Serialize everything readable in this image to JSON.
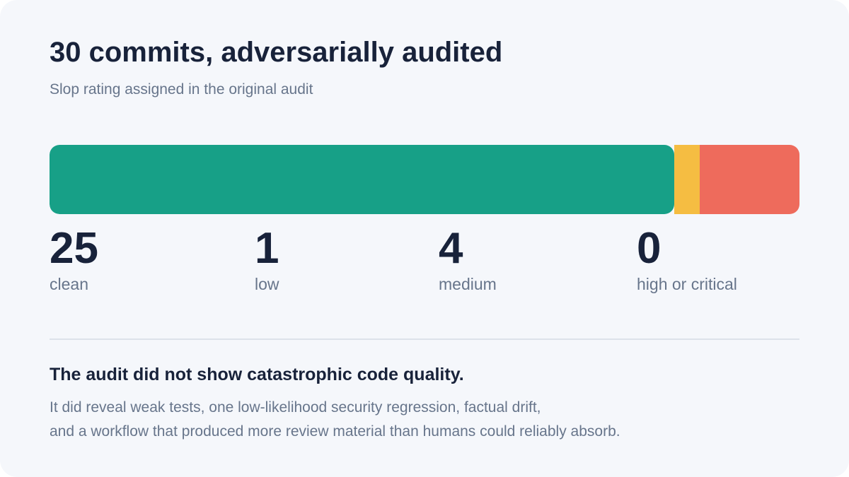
{
  "card": {
    "title": "30 commits, adversarially audited",
    "subtitle": "Slop rating assigned in the original audit"
  },
  "chart_data": {
    "type": "bar",
    "orientation": "horizontal-stacked",
    "total": 30,
    "categories": [
      "clean",
      "low",
      "medium",
      "high or critical"
    ],
    "values": [
      25,
      1,
      4,
      0
    ],
    "colors": [
      "#17a087",
      "#f5bd42",
      "#ee6b5c",
      "#c53b3b"
    ]
  },
  "stats": [
    {
      "value": "25",
      "label": "clean"
    },
    {
      "value": "1",
      "label": "low"
    },
    {
      "value": "4",
      "label": "medium"
    },
    {
      "value": "0",
      "label": "high or critical"
    }
  ],
  "note": {
    "heading": "The audit did not show catastrophic code quality.",
    "line1": "It did reveal weak tests, one low-likelihood security regression, factual drift,",
    "line2": "and a workflow that produced more review material than humans could reliably absorb."
  }
}
